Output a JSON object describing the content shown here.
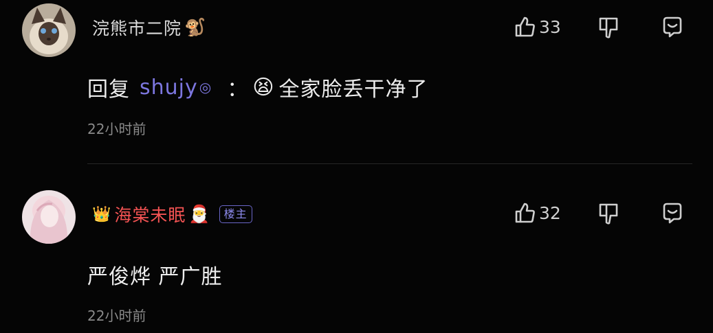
{
  "comments": [
    {
      "username": "浣熊市二院",
      "username_emoji": "🐒",
      "likes": "33",
      "text_prefix": "回复",
      "mention": "shujy",
      "mention_mark": "◎",
      "colon": "：",
      "emoji": "😫",
      "text": "全家脸丢干净了",
      "time": "22小时前"
    },
    {
      "crown": "👑",
      "username": "海棠未眠",
      "username_emoji": "🎅",
      "badge": "楼主",
      "likes": "32",
      "text": "严俊烨 严广胜",
      "time": "22小时前"
    }
  ],
  "colors": {
    "background": "#050505",
    "op_username": "#f35353",
    "mention": "#7d77e0",
    "badge": "#8f8cf0"
  },
  "icons": [
    "thumbs-up-icon",
    "thumbs-down-icon",
    "reply-bubble-icon",
    "crown-icon"
  ]
}
